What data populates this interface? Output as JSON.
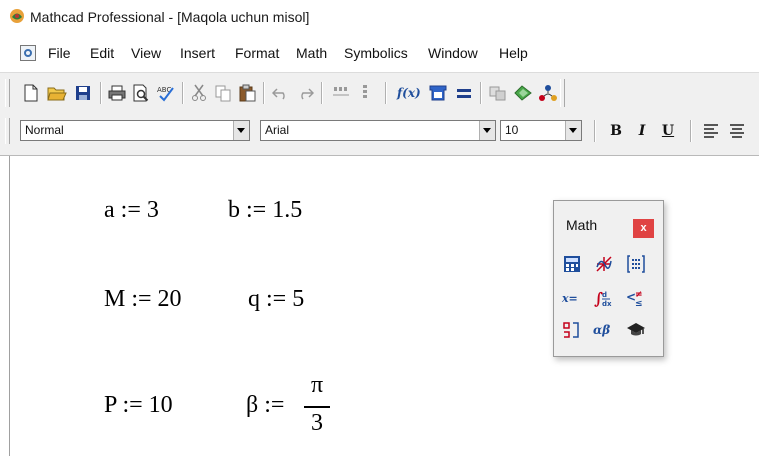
{
  "window": {
    "title": "Mathcad Professional - [Maqola uchun misol]"
  },
  "menu": {
    "items": [
      "File",
      "Edit",
      "View",
      "Insert",
      "Format",
      "Math",
      "Symbolics",
      "Window",
      "Help"
    ]
  },
  "format_toolbar": {
    "style_value": "Normal",
    "font_value": "Arial",
    "size_value": "10",
    "bold_label": "B",
    "italic_label": "I",
    "underline_label": "U"
  },
  "worksheet": {
    "row1": {
      "expr1": "a := 3",
      "expr2": "b := 1.5"
    },
    "row2": {
      "expr1": "M := 20",
      "expr2": "q := 5"
    },
    "row3": {
      "expr1": "P := 10",
      "expr2_lhs": "β :=",
      "numerator": "π",
      "denominator": "3"
    }
  },
  "math_palette": {
    "title": "Math",
    "close_label": "x",
    "buttons": [
      {
        "icon": "calculator-icon",
        "glyph": "▦"
      },
      {
        "icon": "graph-icon",
        "glyph": "⇪"
      },
      {
        "icon": "matrix-icon",
        "glyph": "[⋮]"
      },
      {
        "icon": "evaluation-icon",
        "glyph": "x="
      },
      {
        "icon": "calculus-icon",
        "glyph": "∫"
      },
      {
        "icon": "boolean-icon",
        "glyph": "<≠"
      },
      {
        "icon": "programming-icon",
        "glyph": "ⵇ"
      },
      {
        "icon": "greek-icon",
        "glyph": "αβ"
      },
      {
        "icon": "symbolic-icon",
        "glyph": "◆"
      }
    ]
  },
  "colors": {
    "toolbar_bg": "#f0f0f0",
    "close_button": "#e04343",
    "accent_blue": "#1f4e9c",
    "highlight_red": "#c4001a"
  }
}
